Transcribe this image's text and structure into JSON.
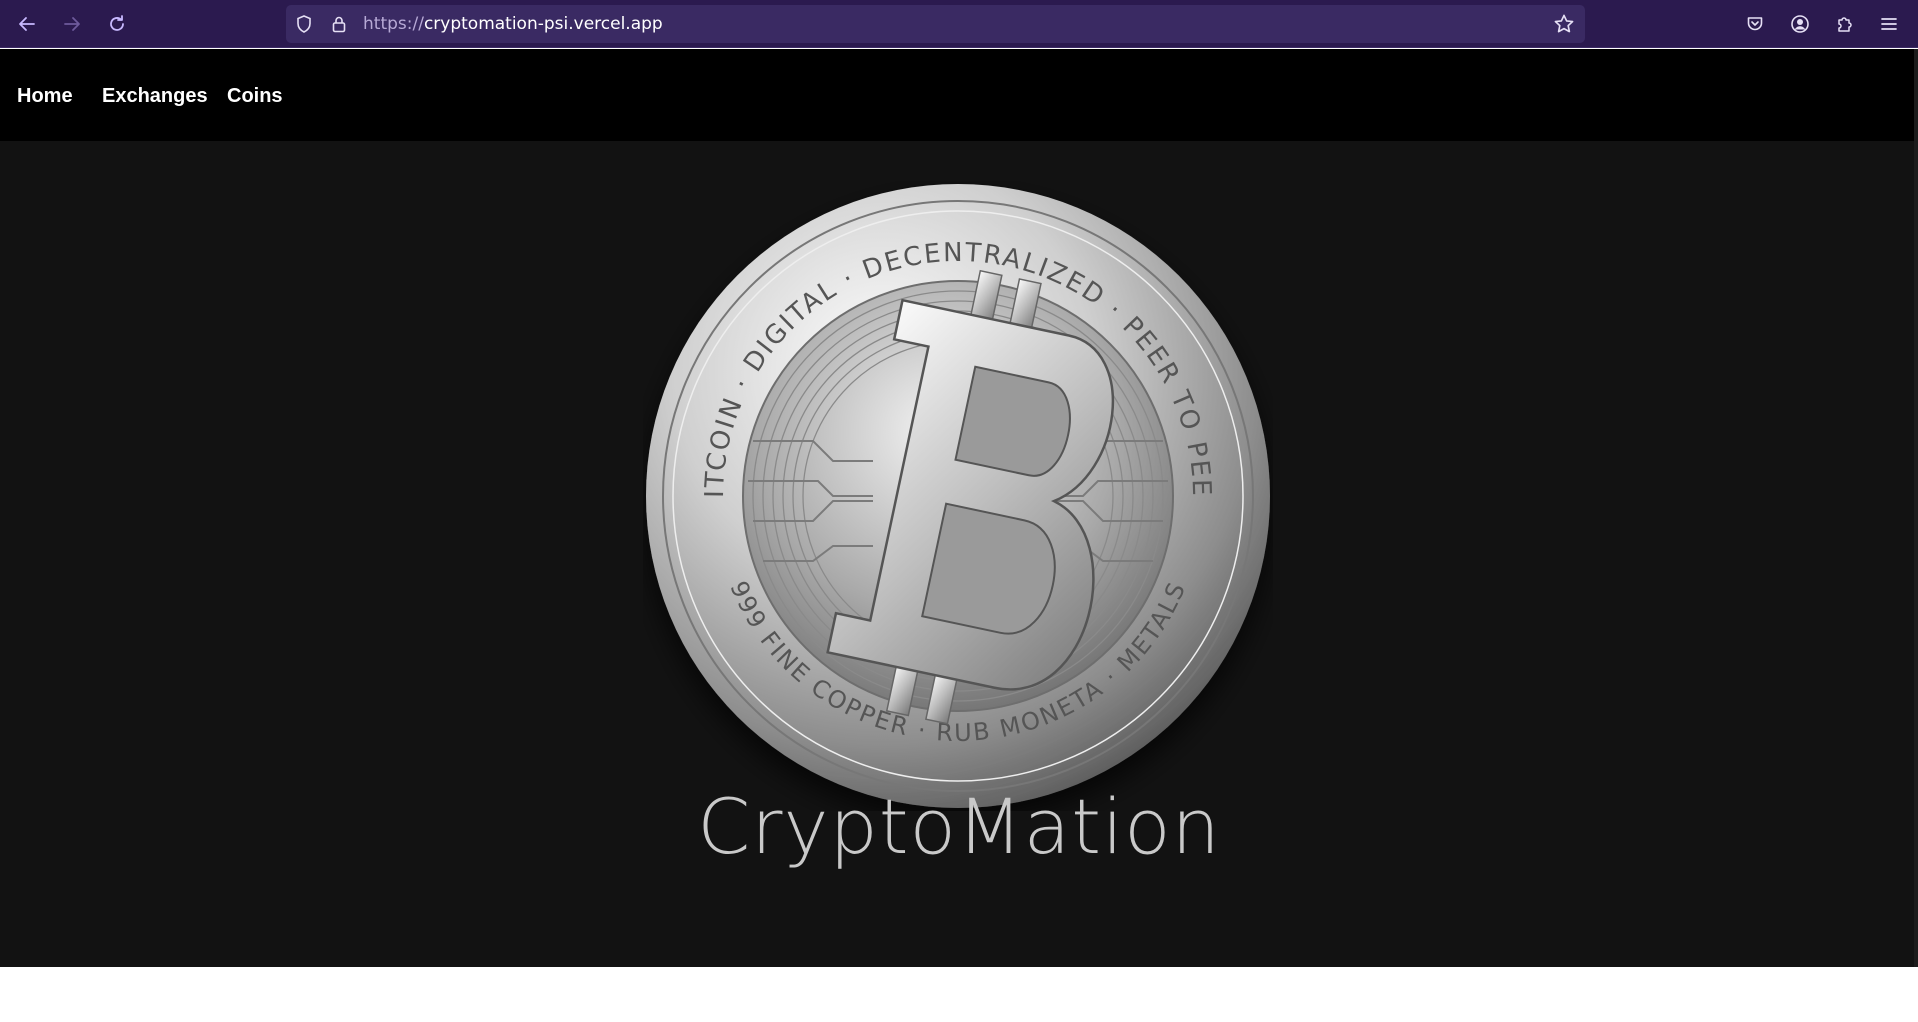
{
  "browser": {
    "url_scheme": "https://",
    "url_host": "cryptomation-psi.vercel.app",
    "icons": [
      "back-arrow-icon",
      "forward-arrow-icon",
      "reload-icon",
      "shield-icon",
      "lock-icon",
      "star-icon",
      "pocket-icon",
      "account-icon",
      "extensions-icon",
      "menu-icon"
    ]
  },
  "nav": {
    "home": "Home",
    "exchanges": "Exchanges",
    "coins": "Coins"
  },
  "hero": {
    "brand": "CryptoMation",
    "coin_top_text": "BITCOIN · DIGITAL · DECENTRALIZED · PEER TO PEER",
    "coin_bottom_text": "999 FINE COPPER · RUB MONETA · METALS"
  },
  "colors": {
    "chrome": "#2b1a4f",
    "urlbar": "#3a2a63",
    "navbar": "#000000",
    "page_bg": "#121212",
    "brand_text": "#c9c9c9"
  }
}
